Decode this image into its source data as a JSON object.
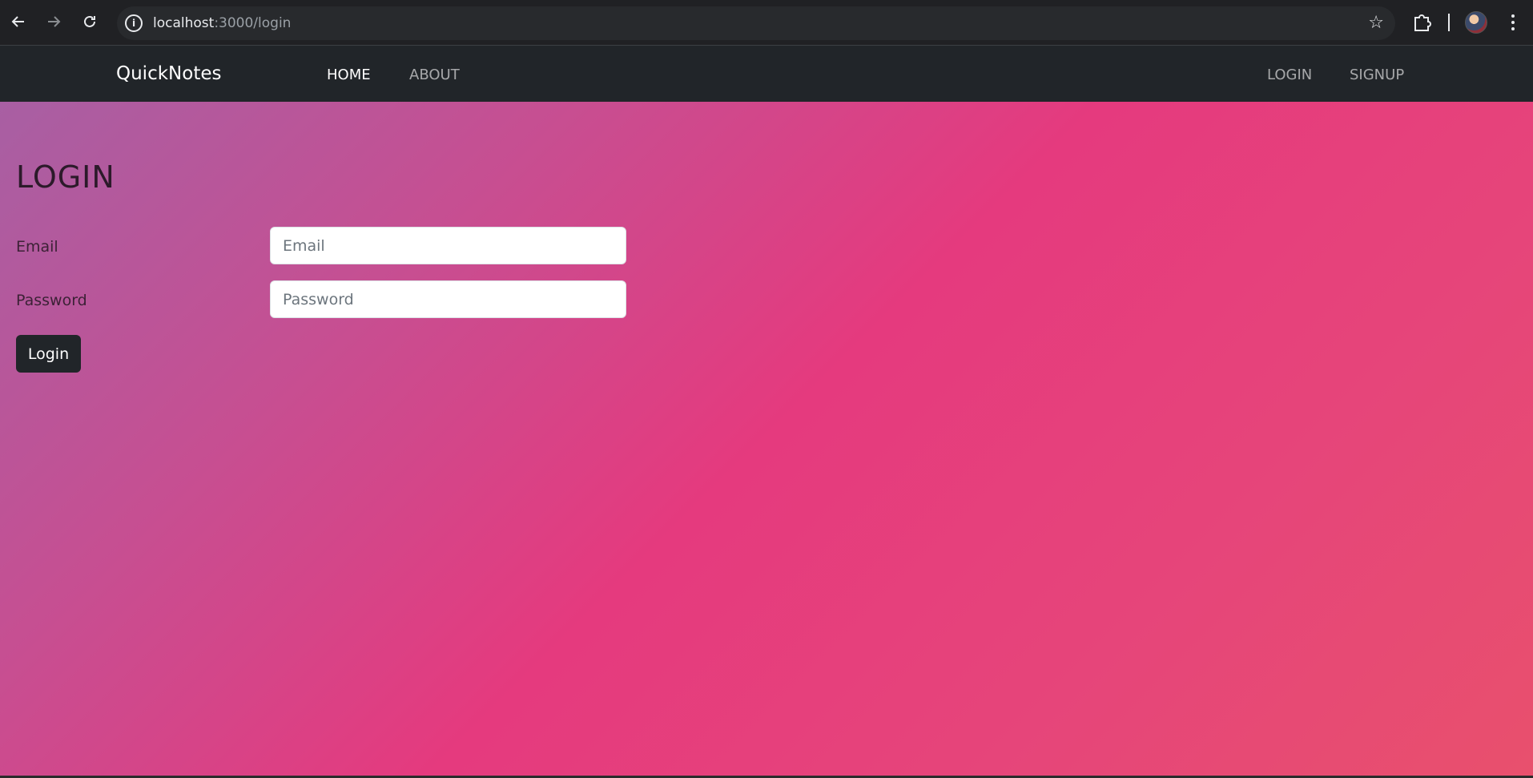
{
  "browser": {
    "url_host": "localhost",
    "url_path": ":3000/login",
    "icons": {
      "back": "arrow-left-icon",
      "forward": "arrow-right-icon",
      "reload": "reload-icon",
      "site_info": "info-icon",
      "bookmark": "star-icon",
      "extensions": "puzzle-icon",
      "profile": "avatar",
      "menu": "kebab-icon"
    }
  },
  "navbar": {
    "brand": "QuickNotes",
    "links": [
      {
        "label": "HOME",
        "active": true
      },
      {
        "label": "ABOUT",
        "active": false
      }
    ],
    "auth_links": [
      {
        "label": "LOGIN"
      },
      {
        "label": "SIGNUP"
      }
    ]
  },
  "login_form": {
    "title": "LOGIN",
    "email": {
      "label": "Email",
      "placeholder": "Email",
      "value": ""
    },
    "password": {
      "label": "Password",
      "placeholder": "Password",
      "value": ""
    },
    "submit_label": "Login"
  },
  "colors": {
    "navbar_bg": "#212529",
    "gradient_start": "#a85fa3",
    "gradient_mid": "#e53a7e",
    "gradient_end": "#e8506d",
    "button_bg": "#212529"
  }
}
